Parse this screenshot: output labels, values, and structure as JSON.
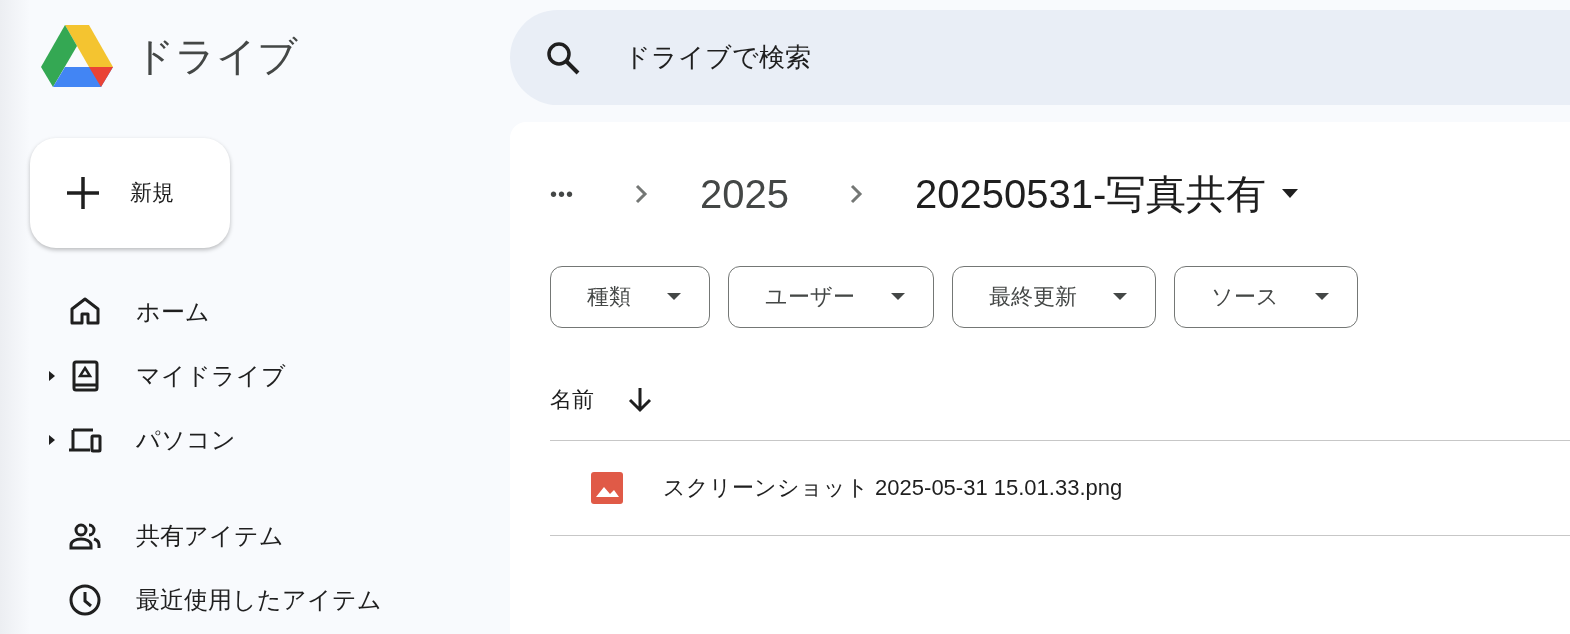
{
  "app": {
    "title": "ドライブ"
  },
  "search": {
    "placeholder": "ドライブで検索"
  },
  "new_button": {
    "label": "新規"
  },
  "sidebar": {
    "groups": [
      [
        {
          "label": "ホーム",
          "expandable": false
        },
        {
          "label": "マイドライブ",
          "expandable": true
        },
        {
          "label": "パソコン",
          "expandable": true
        }
      ],
      [
        {
          "label": "共有アイテム",
          "expandable": false
        },
        {
          "label": "最近使用したアイテム",
          "expandable": false
        }
      ]
    ]
  },
  "breadcrumb": {
    "overflow": "•••",
    "items": [
      "2025",
      "20250531-写真共有"
    ]
  },
  "filters": [
    "種類",
    "ユーザー",
    "最終更新",
    "ソース"
  ],
  "table": {
    "columns": [
      {
        "label": "名前",
        "sorted": true
      }
    ],
    "rows": [
      {
        "name": "スクリーンショット 2025-05-31 15.01.33.png"
      }
    ]
  }
}
